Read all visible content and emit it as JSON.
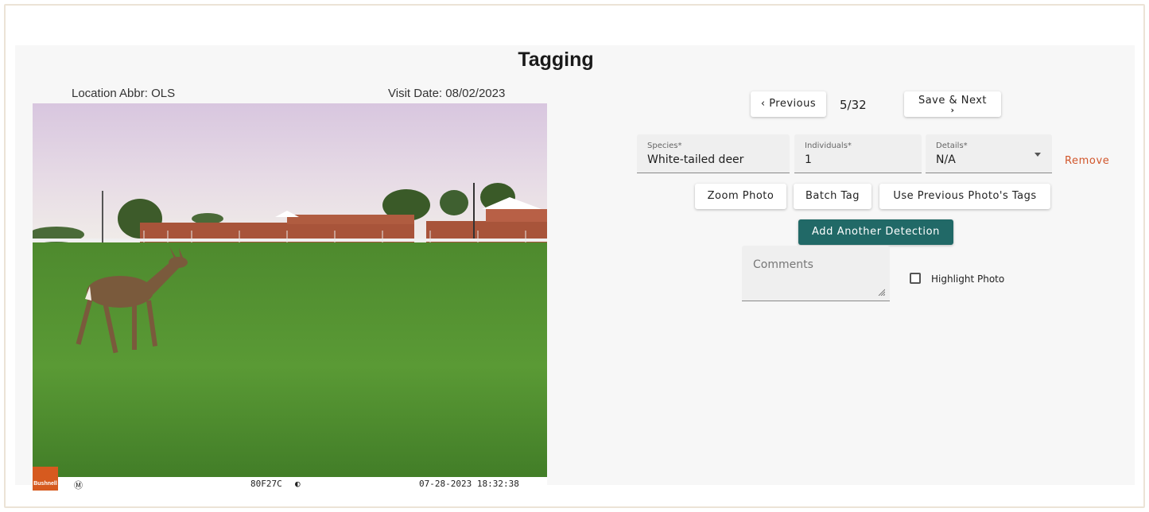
{
  "page": {
    "title": "Tagging"
  },
  "photo_info": {
    "location": "Location Abbr: OLS",
    "visit_date": "Visit Date: 08/02/2023"
  },
  "photo_overlay": {
    "brand": "Bushnell",
    "mode_icon": "Ⓜ",
    "camera_id": "80F27C",
    "moon_icon": "◐",
    "timestamp": "07-28-2023 18:32:38"
  },
  "nav": {
    "previous_label": "Previous",
    "counter": "5/32",
    "save_next_label": "Save & Next",
    "chevron_left": "‹",
    "chevron_right": "›"
  },
  "detection": {
    "species_label": "Species*",
    "species_value": "White-tailed deer",
    "individuals_label": "Individuals*",
    "individuals_value": "1",
    "details_label": "Details*",
    "details_value": "N/A",
    "remove_label": "Remove"
  },
  "actions": {
    "zoom_label": "Zoom Photo",
    "batch_label": "Batch Tag",
    "prev_tags_label": "Use Previous Photo's Tags",
    "add_detection_label": "Add Another Detection"
  },
  "comments": {
    "placeholder": "Comments"
  },
  "highlight": {
    "label": "Highlight Photo",
    "checked": false
  },
  "colors": {
    "accent": "#216967",
    "remove": "#d1562b",
    "brand": "#d65a1f"
  }
}
